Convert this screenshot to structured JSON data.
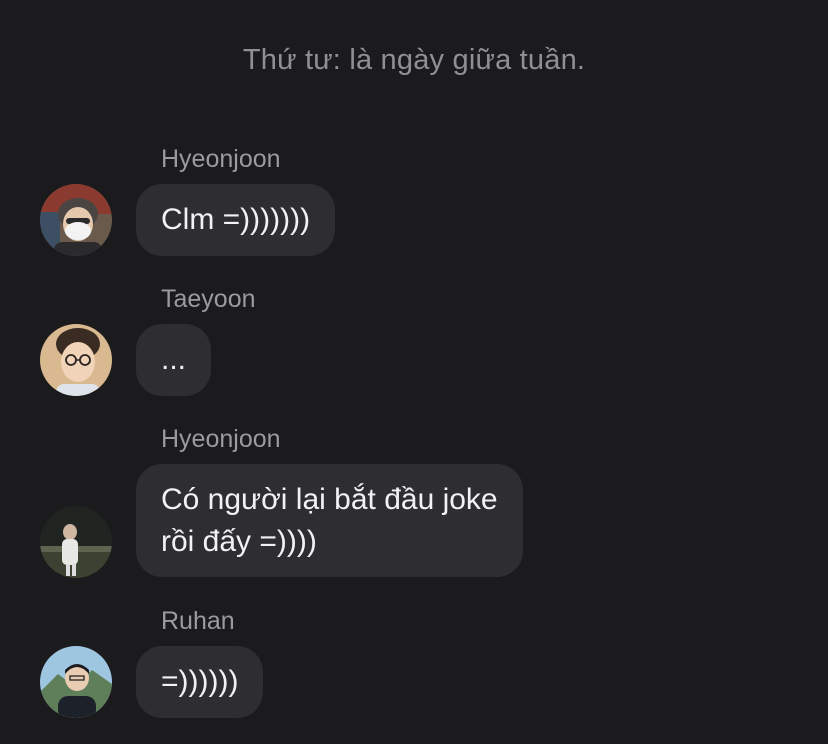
{
  "system_message": "Thứ tư: là ngày giữa tuần.",
  "messages": [
    {
      "sender": "Hyeonjoon",
      "lines": [
        "Clm =)))))))"
      ],
      "avatar_icon": "avatar-hyeonjoon-masked"
    },
    {
      "sender": "Taeyoon",
      "lines": [
        "..."
      ],
      "avatar_icon": "avatar-taeyoon-glasses"
    },
    {
      "sender": "Hyeonjoon",
      "lines": [
        "Có người lại bắt đầu joke",
        "rồi đấy =))))"
      ],
      "avatar_icon": "avatar-hyeonjoon-outdoor"
    },
    {
      "sender": "Ruhan",
      "lines": [
        "=))))))"
      ],
      "avatar_icon": "avatar-ruhan-mountain"
    }
  ],
  "colors": {
    "background": "#1b1b1d",
    "bubble": "#2e2e31",
    "bubble_text": "#f2f2f4",
    "meta_text": "#9a9aa1"
  }
}
